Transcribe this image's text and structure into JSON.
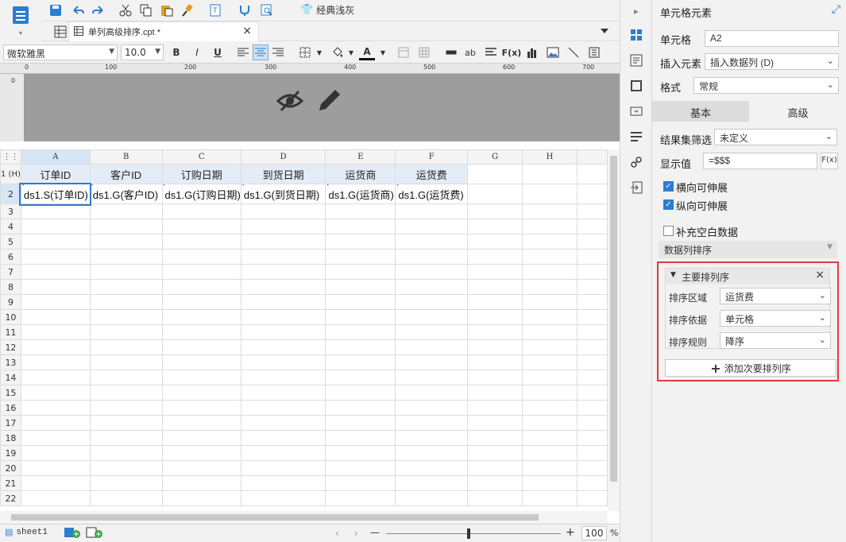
{
  "toolbar": {
    "theme_label": "经典浅灰"
  },
  "tab": {
    "title": "单列高级排序.cpt *",
    "close": "×"
  },
  "format_bar": {
    "font_family": "微软雅黑",
    "font_size": "10.0",
    "bold": "B",
    "italic": "I",
    "underline": "U",
    "font_color_glyph": "A"
  },
  "ruler": {
    "marks": [
      "0",
      "100",
      "200",
      "300",
      "400",
      "500",
      "600",
      "700"
    ],
    "vmark": "0"
  },
  "grid": {
    "corner": "⋮⋮",
    "columns": [
      "A",
      "B",
      "C",
      "D",
      "E",
      "F",
      "G",
      "H"
    ],
    "row_labels": [
      "1 (H)",
      "2",
      "3",
      "4",
      "5",
      "6",
      "7",
      "8",
      "9",
      "10",
      "11",
      "12",
      "13",
      "14",
      "15",
      "16",
      "17",
      "18",
      "19",
      "20",
      "21",
      "22"
    ],
    "header_row": [
      "订单ID",
      "客户ID",
      "订购日期",
      "到货日期",
      "运货商",
      "运货费"
    ],
    "data_row": [
      "ds1.S(订单ID)",
      "ds1.G(客户ID)",
      "ds1.G(订购日期)",
      "ds1.G(到货日期)",
      "ds1.G(运货商)",
      "ds1.G(运货费)"
    ]
  },
  "status": {
    "sheet_name": "sheet1",
    "zoom": "100",
    "zoom_unit": "%",
    "minus": "—",
    "plus": "+"
  },
  "panel": {
    "title": "单元格元素",
    "cell_label": "单元格",
    "cell_value": "A2",
    "insert_label": "插入元素",
    "insert_value": "插入数据列 (D)",
    "format_label": "格式",
    "format_value": "常规",
    "tab_basic": "基本",
    "tab_advanced": "高级",
    "filter_label": "结果集筛选",
    "filter_value": "未定义",
    "display_label": "显示值",
    "display_value": "=$$$",
    "fx": "F(x)",
    "expand_h": "横向可伸展",
    "expand_v": "纵向可伸展",
    "fill_blank": "补充空白数据",
    "sort_section": "数据列排序",
    "primary_sort": "主要排列序",
    "sort_area_label": "排序区域",
    "sort_area_value": "运货费",
    "sort_basis_label": "排序依据",
    "sort_basis_value": "单元格",
    "sort_rule_label": "排序规则",
    "sort_rule_value": "降序",
    "add_secondary": "添加次要排列序"
  },
  "colors": {
    "accent": "#2b7cd3",
    "header_fill": "#e4ecf7",
    "highlight_border": "#e03a3a",
    "canvas_gray": "#9d9d9d"
  }
}
